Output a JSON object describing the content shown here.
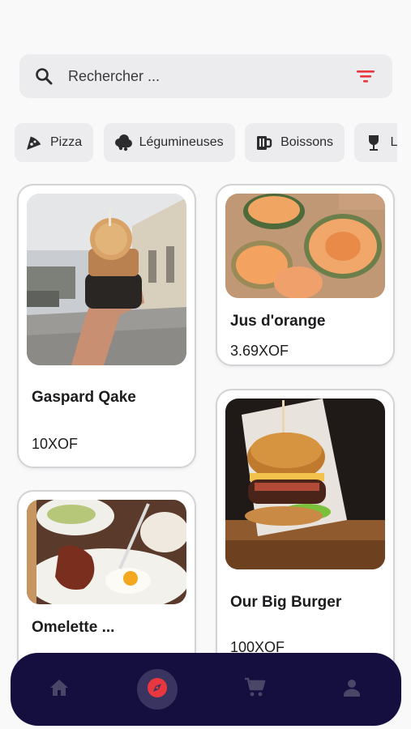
{
  "search": {
    "placeholder": "Rechercher ...",
    "icon": "search-icon",
    "filter_icon": "filter-icon",
    "filter_color": "#e8373f"
  },
  "categories": [
    {
      "label": "Pizza",
      "icon": "pizza-icon"
    },
    {
      "label": "Légumineuses",
      "icon": "leafy-cloud-icon"
    },
    {
      "label": "Boissons",
      "icon": "mug-icon"
    },
    {
      "label": "Le",
      "icon": "wine-glass-icon"
    }
  ],
  "products": [
    {
      "name": "Gaspard Qake",
      "price": "10XOF",
      "image": "ice-cream-cone-photo"
    },
    {
      "name": "Jus d'orange",
      "price": "3.69XOF",
      "image": "melon-slices-photo"
    },
    {
      "name": "Omelette ...",
      "price": "",
      "image": "breakfast-plate-photo"
    },
    {
      "name": "Our Big Burger",
      "price": "100XOF",
      "image": "burger-photo"
    }
  ],
  "nav": {
    "items": [
      {
        "icon": "home-icon",
        "active": false
      },
      {
        "icon": "compass-icon",
        "active": true
      },
      {
        "icon": "cart-icon",
        "active": false
      },
      {
        "icon": "user-icon",
        "active": false
      }
    ],
    "active_accent": "#e8373f",
    "background": "#150f3f"
  }
}
